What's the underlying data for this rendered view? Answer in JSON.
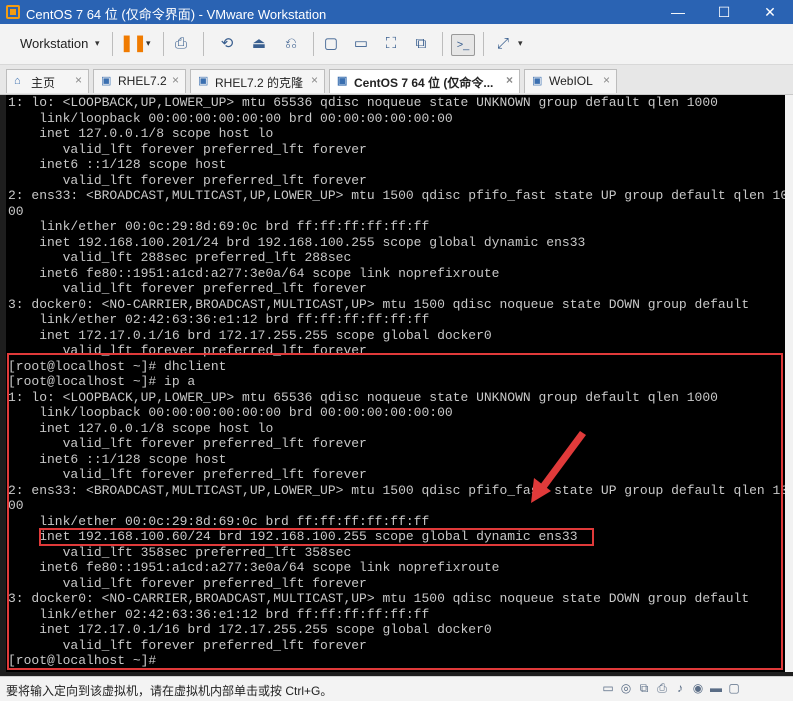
{
  "window": {
    "title": "CentOS 7 64 位 (仅命令界面) - VMware Workstation",
    "icons": {
      "app": "vmware-icon",
      "minimize": "—",
      "maximize": "☐",
      "close": "✕"
    }
  },
  "toolbar": {
    "workstation_label": "Workstation",
    "caret": "▾",
    "icons": {
      "pause": "❚❚",
      "print": "⎙",
      "snapshot": "⟲",
      "revert": "⏏",
      "manage": "⎌",
      "view1": "▢",
      "view2": "▭",
      "fullscreen": "⛶",
      "unity": "⧉",
      "console": ">_",
      "stretch": "⤢"
    }
  },
  "tabs": [
    {
      "label": "主页",
      "icon": "⌂"
    },
    {
      "label": "RHEL7.2",
      "icon": "▣"
    },
    {
      "label": "RHEL7.2 的克隆",
      "icon": "▣"
    },
    {
      "label": "CentOS 7 64 位 (仅命令...",
      "icon": "▣"
    },
    {
      "label": "WebIOL",
      "icon": "▣"
    }
  ],
  "tab_close": "×",
  "console_lines": [
    "1: lo: <LOOPBACK,UP,LOWER_UP> mtu 65536 qdisc noqueue state UNKNOWN group default qlen 1000",
    "    link/loopback 00:00:00:00:00:00 brd 00:00:00:00:00:00",
    "    inet 127.0.0.1/8 scope host lo",
    "       valid_lft forever preferred_lft forever",
    "    inet6 ::1/128 scope host",
    "       valid_lft forever preferred_lft forever",
    "2: ens33: <BROADCAST,MULTICAST,UP,LOWER_UP> mtu 1500 qdisc pfifo_fast state UP group default qlen 10",
    "00",
    "    link/ether 00:0c:29:8d:69:0c brd ff:ff:ff:ff:ff:ff",
    "    inet 192.168.100.201/24 brd 192.168.100.255 scope global dynamic ens33",
    "       valid_lft 288sec preferred_lft 288sec",
    "    inet6 fe80::1951:a1cd:a277:3e0a/64 scope link noprefixroute",
    "       valid_lft forever preferred_lft forever",
    "3: docker0: <NO-CARRIER,BROADCAST,MULTICAST,UP> mtu 1500 qdisc noqueue state DOWN group default",
    "    link/ether 02:42:63:36:e1:12 brd ff:ff:ff:ff:ff:ff",
    "    inet 172.17.0.1/16 brd 172.17.255.255 scope global docker0",
    "       valid_lft forever preferred_lft forever",
    "[root@localhost ~]# dhclient",
    "[root@localhost ~]# ip a",
    "1: lo: <LOOPBACK,UP,LOWER_UP> mtu 65536 qdisc noqueue state UNKNOWN group default qlen 1000",
    "    link/loopback 00:00:00:00:00:00 brd 00:00:00:00:00:00",
    "    inet 127.0.0.1/8 scope host lo",
    "       valid_lft forever preferred_lft forever",
    "    inet6 ::1/128 scope host",
    "       valid_lft forever preferred_lft forever",
    "2: ens33: <BROADCAST,MULTICAST,UP,LOWER_UP> mtu 1500 qdisc pfifo_fast state UP group default qlen 10",
    "00",
    "    link/ether 00:0c:29:8d:69:0c brd ff:ff:ff:ff:ff:ff",
    "    inet 192.168.100.60/24 brd 192.168.100.255 scope global dynamic ens33",
    "       valid_lft 358sec preferred_lft 358sec",
    "    inet6 fe80::1951:a1cd:a277:3e0a/64 scope link noprefixroute",
    "       valid_lft forever preferred_lft forever",
    "3: docker0: <NO-CARRIER,BROADCAST,MULTICAST,UP> mtu 1500 qdisc noqueue state DOWN group default",
    "    link/ether 02:42:63:36:e1:12 brd ff:ff:ff:ff:ff:ff",
    "    inet 172.17.0.1/16 brd 172.17.255.255 scope global docker0",
    "       valid_lft forever preferred_lft forever",
    "[root@localhost ~]#"
  ],
  "status": {
    "text": "要将输入定向到该虚拟机，请在虚拟机内部单击或按 Ctrl+G。",
    "icons": [
      "▭",
      "◎",
      "⧉",
      "⎙",
      "♪",
      "◉",
      "▬",
      "▢"
    ]
  },
  "colors": {
    "highlight": "#e03a3a",
    "title_bar": "#2a63b3",
    "pause": "#f07b00"
  }
}
